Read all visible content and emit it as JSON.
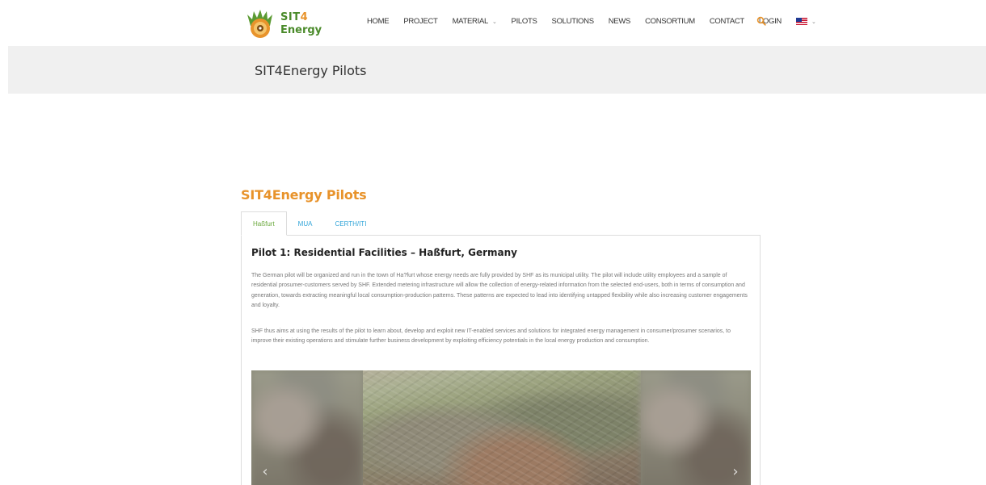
{
  "header": {
    "logo": {
      "line1": "SIT",
      "line1_accent": "4",
      "line2": "Energy"
    },
    "nav": [
      {
        "label": "HOME",
        "has_dropdown": false
      },
      {
        "label": "PROJECT",
        "has_dropdown": false
      },
      {
        "label": "MATERIAL",
        "has_dropdown": true
      },
      {
        "label": "PILOTS",
        "has_dropdown": false
      },
      {
        "label": "SOLUTIONS",
        "has_dropdown": false
      },
      {
        "label": "NEWS",
        "has_dropdown": false
      },
      {
        "label": "CONSORTIUM",
        "has_dropdown": false
      },
      {
        "label": "CONTACT",
        "has_dropdown": false
      },
      {
        "label": "LOGIN",
        "has_dropdown": false
      }
    ],
    "language_icon": "us-flag-icon",
    "search_icon": "search-icon"
  },
  "title_band": {
    "title": "SIT4Energy Pilots"
  },
  "section": {
    "heading": "SIT4Energy Pilots",
    "tabs": [
      {
        "label": "Haßfurt",
        "active": true
      },
      {
        "label": "MUA",
        "active": false
      },
      {
        "label": "CERTH/ITI",
        "active": false
      }
    ],
    "panel": {
      "heading": "Pilot 1: Residential Facilities – Haßfurt, Germany",
      "paragraph1": "The German pilot will be organized and run in the town of Ha?furt whose energy needs are fully provided by SHF as its municipal utility. The pilot will include utility employees and a sample of residential prosumer-customers served by SHF. Extended metering infrastructure will allow the collection of energy-related information from the selected end-users, both in terms of consumption and generation, towards extracting meaningful local consumption-production patterns. These patterns are expected to lead into identifying untapped flexibility while also increasing customer engagements and loyalty.",
      "paragraph2": "SHF thus aims at using the results of the pilot to learn about, develop and exploit new IT-enabled services and solutions for integrated energy management in consumer/prosumer scenarios, to improve their existing operations and stimulate further business development by exploiting efficiency potentials in the local energy production and consumption."
    },
    "carousel": {
      "prev_icon": "chevron-left-icon",
      "next_icon": "chevron-right-icon",
      "prev_glyph": "‹",
      "next_glyph": "›"
    }
  },
  "colors": {
    "accent_orange": "#e8932b",
    "logo_green": "#4a8a2a",
    "tab_active_green": "#6aa83c",
    "tab_inactive_blue": "#2fa4d8",
    "title_band_bg": "#f0f0f0"
  }
}
